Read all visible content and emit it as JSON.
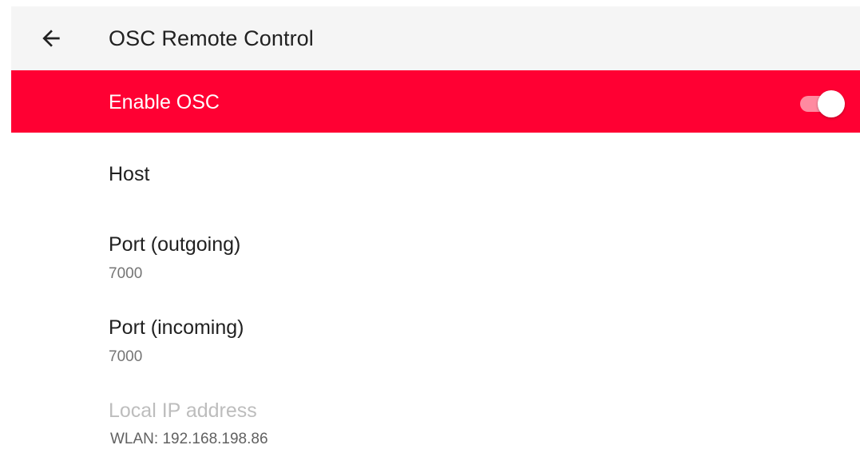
{
  "app_bar": {
    "back_icon": "arrow-back-icon",
    "title": "OSC Remote Control",
    "background": "#f5f5f5"
  },
  "master_switch": {
    "label": "Enable OSC",
    "checked": true,
    "background": "#ff0033",
    "track_color": "#ff8aa0",
    "thumb_color": "#ffffff"
  },
  "preferences": {
    "host": {
      "title": "Host"
    },
    "port_outgoing": {
      "title": "Port (outgoing)",
      "summary": "7000"
    },
    "port_incoming": {
      "title": "Port (incoming)",
      "summary": "7000"
    },
    "local_ip": {
      "title": "Local IP address",
      "summary": "WLAN: 192.168.198.86",
      "enabled": false
    }
  }
}
